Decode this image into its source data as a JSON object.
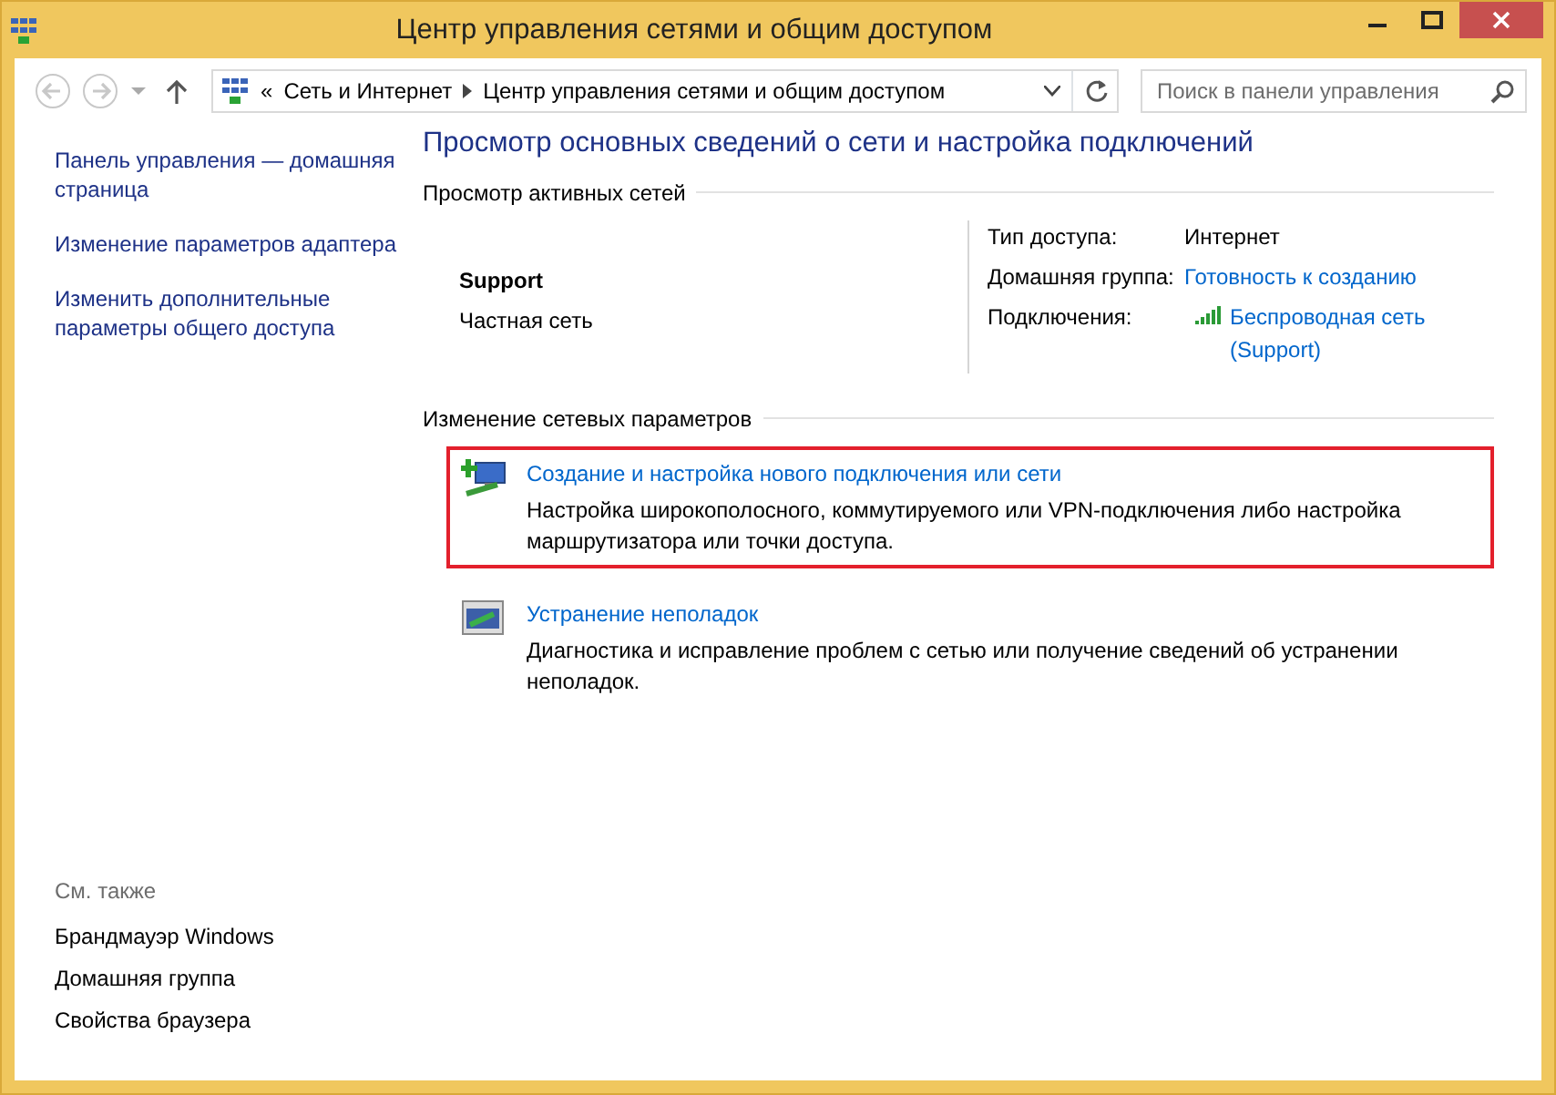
{
  "window": {
    "title": "Центр управления сетями и общим доступом"
  },
  "address_bar": {
    "prefix": "«",
    "path": [
      "Сеть и Интернет",
      "Центр управления сетями и общим доступом"
    ]
  },
  "search": {
    "placeholder": "Поиск в панели управления"
  },
  "sidebar": {
    "links": [
      "Панель управления — домашняя страница",
      "Изменение параметров адаптера",
      "Изменить дополнительные параметры общего доступа"
    ],
    "see_also_title": "См. также",
    "see_also": [
      "Брандмауэр Windows",
      "Домашняя группа",
      "Свойства браузера"
    ]
  },
  "heading": "Просмотр основных сведений о сети и настройка подключений",
  "active_networks": {
    "title": "Просмотр активных сетей",
    "name": "Support",
    "type": "Частная сеть",
    "details": [
      {
        "label": "Тип доступа:",
        "value": "Интернет",
        "kind": "text"
      },
      {
        "label": "Домашняя группа:",
        "value": "Готовность к созданию",
        "kind": "link"
      },
      {
        "label": "Подключения:",
        "value": "Беспроводная сеть (Support)",
        "kind": "wifi-link"
      }
    ]
  },
  "change_settings": {
    "title": "Изменение сетевых параметров",
    "tasks": [
      {
        "kind": "new-connection",
        "link": "Создание и настройка нового подключения или сети",
        "description": "Настройка широкополосного, коммутируемого или VPN-подключения либо настройка маршрутизатора или точки доступа.",
        "highlighted": true
      },
      {
        "kind": "troubleshoot",
        "link": "Устранение неполадок",
        "description": "Диагностика и исправление проблем с сетью или получение сведений об устранении неполадок.",
        "highlighted": false
      }
    ]
  }
}
